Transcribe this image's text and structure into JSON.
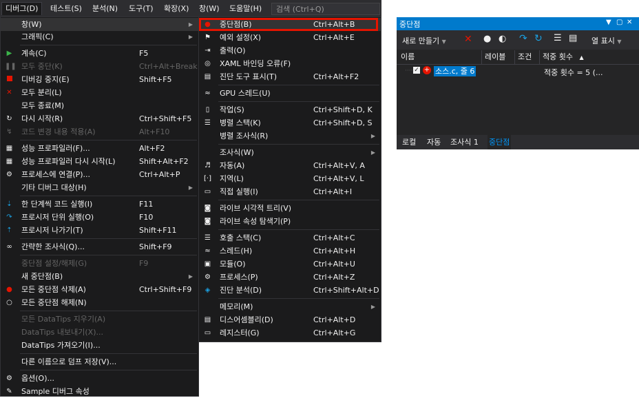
{
  "menubar": {
    "items": [
      "디버그(D)",
      "테스트(S)",
      "분석(N)",
      "도구(T)",
      "확장(X)",
      "창(W)",
      "도움말(H)"
    ],
    "search_placeholder": "검색 (Ctrl+Q)"
  },
  "debug_menu": {
    "items": [
      {
        "label": "창(W)",
        "shortcut": "",
        "submenu": true,
        "highlight": true,
        "icon": ""
      },
      {
        "label": "그래픽(C)",
        "shortcut": "",
        "submenu": true,
        "icon": ""
      },
      {
        "label": "계속(C)",
        "shortcut": "F5",
        "icon": "play-icon"
      },
      {
        "label": "모두 중단(K)",
        "shortcut": "Ctrl+Alt+Break",
        "disabled": true,
        "icon": "pause-icon"
      },
      {
        "label": "디버깅 중지(E)",
        "shortcut": "Shift+F5",
        "icon": "stop-icon"
      },
      {
        "label": "모두 분리(L)",
        "shortcut": "",
        "icon": "detach-icon"
      },
      {
        "label": "모두 종료(M)",
        "shortcut": "",
        "icon": ""
      },
      {
        "label": "다시 시작(R)",
        "shortcut": "Ctrl+Shift+F5",
        "icon": "restart-icon"
      },
      {
        "label": "코드 변경 내용 적용(A)",
        "shortcut": "Alt+F10",
        "disabled": true,
        "icon": "apply-changes-icon"
      },
      {
        "label": "성능 프로파일러(F)...",
        "shortcut": "Alt+F2",
        "icon": "profiler-icon"
      },
      {
        "label": "성능 프로파일러 다시 시작(L)",
        "shortcut": "Shift+Alt+F2",
        "icon": "profiler-restart-icon"
      },
      {
        "label": "프로세스에 연결(P)...",
        "shortcut": "Ctrl+Alt+P",
        "icon": "attach-icon"
      },
      {
        "label": "기타 디버그 대상(H)",
        "shortcut": "",
        "submenu": true,
        "icon": ""
      },
      {
        "label": "한 단계씩 코드 실행(I)",
        "shortcut": "F11",
        "icon": "step-into-icon"
      },
      {
        "label": "프로시저 단위 실행(O)",
        "shortcut": "F10",
        "icon": "step-over-icon"
      },
      {
        "label": "프로시저 나가기(T)",
        "shortcut": "Shift+F11",
        "icon": "step-out-icon"
      },
      {
        "label": "간략한 조사식(Q)...",
        "shortcut": "Shift+F9",
        "icon": "quickwatch-icon"
      },
      {
        "label": "중단점 설정/해제(G)",
        "shortcut": "F9",
        "disabled": true,
        "icon": ""
      },
      {
        "label": "새 중단점(B)",
        "shortcut": "",
        "submenu": true,
        "icon": ""
      },
      {
        "label": "모든 중단점 삭제(A)",
        "shortcut": "Ctrl+Shift+F9",
        "icon": "delete-breakpoints-icon"
      },
      {
        "label": "모든 중단점 해제(N)",
        "shortcut": "",
        "icon": "disable-breakpoints-icon"
      },
      {
        "label": "모든 DataTips 지우기(A)",
        "shortcut": "",
        "disabled": true,
        "icon": ""
      },
      {
        "label": "DataTips 내보내기(X)...",
        "shortcut": "",
        "disabled": true,
        "icon": ""
      },
      {
        "label": "DataTips 가져오기(I)...",
        "shortcut": "",
        "icon": ""
      },
      {
        "label": "다른 이름으로 덤프 저장(V)...",
        "shortcut": "",
        "icon": ""
      },
      {
        "label": "옵션(O)...",
        "shortcut": "",
        "icon": "gear-icon"
      },
      {
        "label": "Sample 디버그 속성",
        "shortcut": "",
        "icon": "wrench-icon"
      }
    ]
  },
  "window_menu": {
    "items": [
      {
        "label": "중단점(B)",
        "shortcut": "Ctrl+Alt+B",
        "icon": "breakpoint-window-icon"
      },
      {
        "label": "예외 설정(X)",
        "shortcut": "Ctrl+Alt+E",
        "icon": "exception-icon"
      },
      {
        "label": "출력(O)",
        "shortcut": "",
        "icon": "output-icon"
      },
      {
        "label": "XAML 바인딩 오류(F)",
        "shortcut": "",
        "icon": "xaml-icon"
      },
      {
        "label": "진단 도구 표시(T)",
        "shortcut": "Ctrl+Alt+F2",
        "icon": "diagnostic-tools-icon"
      },
      {
        "label": "GPU 스레드(U)",
        "shortcut": "",
        "icon": "gpu-threads-icon"
      },
      {
        "label": "작업(S)",
        "shortcut": "Ctrl+Shift+D, K",
        "icon": "tasks-icon"
      },
      {
        "label": "병렬 스택(K)",
        "shortcut": "Ctrl+Shift+D, S",
        "icon": "parallel-stacks-icon"
      },
      {
        "label": "병렬 조사식(R)",
        "shortcut": "",
        "submenu": true,
        "icon": ""
      },
      {
        "label": "조사식(W)",
        "shortcut": "",
        "submenu": true,
        "icon": ""
      },
      {
        "label": "자동(A)",
        "shortcut": "Ctrl+Alt+V, A",
        "icon": "autos-icon"
      },
      {
        "label": "지역(L)",
        "shortcut": "Ctrl+Alt+V, L",
        "icon": "locals-icon"
      },
      {
        "label": "직접 실행(I)",
        "shortcut": "Ctrl+Alt+I",
        "icon": "immediate-icon"
      },
      {
        "label": "라이브 시각적 트리(V)",
        "shortcut": "",
        "icon": "camera-icon"
      },
      {
        "label": "라이브 속성 탐색기(P)",
        "shortcut": "",
        "icon": "camera-icon"
      },
      {
        "label": "호출 스택(C)",
        "shortcut": "Ctrl+Alt+C",
        "icon": "call-stack-icon"
      },
      {
        "label": "스레드(H)",
        "shortcut": "Ctrl+Alt+H",
        "icon": "threads-icon"
      },
      {
        "label": "모듈(O)",
        "shortcut": "Ctrl+Alt+U",
        "icon": "modules-icon"
      },
      {
        "label": "프로세스(P)",
        "shortcut": "Ctrl+Alt+Z",
        "icon": "processes-icon"
      },
      {
        "label": "진단 분석(D)",
        "shortcut": "Ctrl+Shift+Alt+D",
        "icon": "diagnostic-analysis-icon"
      },
      {
        "label": "메모리(M)",
        "shortcut": "",
        "submenu": true,
        "icon": ""
      },
      {
        "label": "디스어셈블리(D)",
        "shortcut": "Ctrl+Alt+D",
        "icon": "disassembly-icon"
      },
      {
        "label": "레지스터(G)",
        "shortcut": "Ctrl+Alt+G",
        "icon": "registers-icon"
      }
    ]
  },
  "breakpoints_window": {
    "title": "중단점",
    "toolbar": {
      "new_label": "새로 만들기",
      "columns_label": "열 표시"
    },
    "columns": [
      "이름",
      "레이블",
      "조건",
      "적중 횟수"
    ],
    "row": {
      "name": "소스.c, 줄 6",
      "hit_count": "적중 횟수 = 5 (..."
    },
    "tabs": [
      "로컬",
      "자동",
      "조사식 1",
      "중단점"
    ]
  }
}
